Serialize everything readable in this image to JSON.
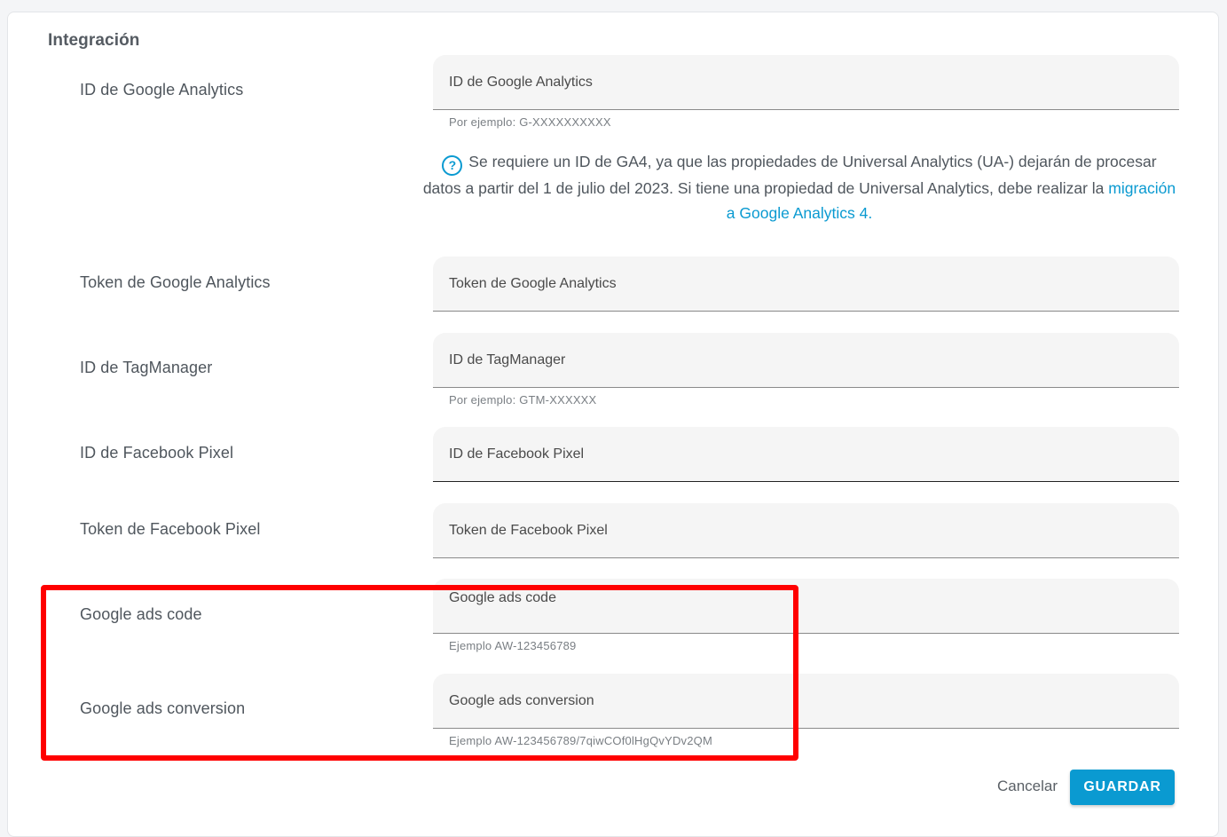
{
  "section": {
    "title": "Integración"
  },
  "rows": {
    "ga_id": {
      "label": "ID de Google Analytics",
      "placeholder": "ID de Google Analytics",
      "hint": "Por ejemplo: G-XXXXXXXXXX"
    },
    "ga_token": {
      "label": "Token de Google Analytics",
      "placeholder": "Token de Google Analytics"
    },
    "tagmanager_id": {
      "label": "ID de TagManager",
      "placeholder": "ID de TagManager",
      "hint": "Por ejemplo: GTM-XXXXXX"
    },
    "fb_pixel_id": {
      "label": "ID de Facebook Pixel",
      "placeholder": "ID de Facebook Pixel"
    },
    "fb_pixel_token": {
      "label": "Token de Facebook Pixel",
      "placeholder": "Token de Facebook Pixel"
    },
    "gads_code": {
      "label": "Google ads code",
      "placeholder": "Google ads code",
      "hint": "Ejemplo AW-123456789"
    },
    "gads_conversion": {
      "label": "Google ads conversion",
      "placeholder": "Google ads conversion",
      "hint": "Ejemplo AW-123456789/7qiwCOf0lHgQvYDv2QM"
    }
  },
  "info": {
    "icon": "help-circle-icon",
    "icon_glyph": "?",
    "text": "Se requiere un ID de GA4, ya que las propiedades de Universal Analytics (UA-) dejarán de procesar datos a partir del 1 de julio del 2023. Si tiene una propiedad de Universal Analytics, debe realizar la",
    "link_text": "migración a Google Analytics 4."
  },
  "actions": {
    "cancel_label": "Cancelar",
    "save_label": "GUARDAR"
  },
  "colors": {
    "accent": "#0a9ad1",
    "highlight": "#ff0000"
  }
}
